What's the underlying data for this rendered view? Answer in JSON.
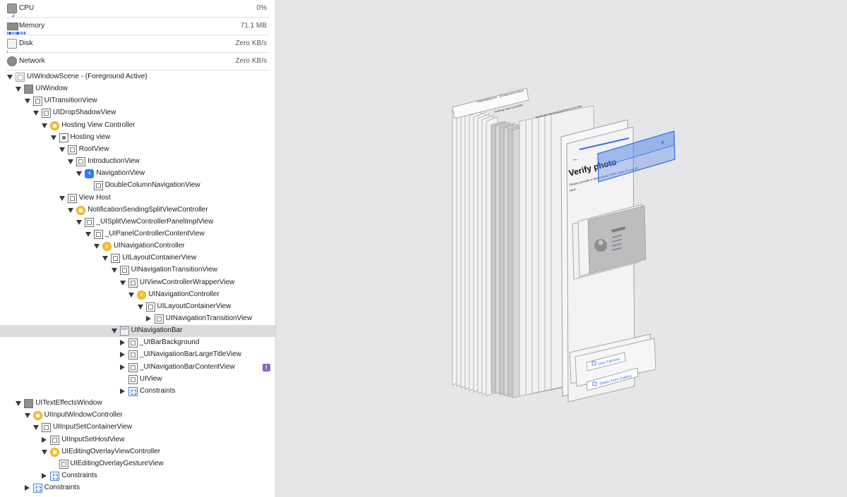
{
  "gauges": [
    {
      "label": "CPU",
      "value": "0%",
      "icon": "cpu-icon"
    },
    {
      "label": "Memory",
      "value": "71.1 MB",
      "icon": "memory-icon"
    },
    {
      "label": "Disk",
      "value": "Zero KB/s",
      "icon": "disk-icon"
    },
    {
      "label": "Network",
      "value": "Zero KB/s",
      "icon": "network-icon"
    }
  ],
  "tree": [
    {
      "label": "UIWindowScene - (Foreground Active)",
      "depth": 0,
      "expand": "open",
      "icon": "scene"
    },
    {
      "label": "UIWindow",
      "depth": 1,
      "expand": "open",
      "icon": "window"
    },
    {
      "label": "UITransitionView",
      "depth": 2,
      "expand": "open",
      "icon": "view"
    },
    {
      "label": "UIDropShadowView",
      "depth": 3,
      "expand": "open",
      "icon": "view"
    },
    {
      "label": "Hosting View Controller",
      "depth": 4,
      "expand": "open",
      "icon": "controller"
    },
    {
      "label": "Hosting view",
      "depth": 5,
      "expand": "open",
      "icon": "hosting"
    },
    {
      "label": "RootView",
      "depth": 6,
      "expand": "open",
      "icon": "view"
    },
    {
      "label": "IntroductionView",
      "depth": 7,
      "expand": "open",
      "icon": "view"
    },
    {
      "label": "NavigationView",
      "depth": 8,
      "expand": "open",
      "icon": "navview"
    },
    {
      "label": "DoubleColumnNavigationView",
      "depth": 9,
      "expand": "none",
      "icon": "view"
    },
    {
      "label": "View Host",
      "depth": 6,
      "expand": "open",
      "icon": "view"
    },
    {
      "label": "NotificationSendingSplitViewController",
      "depth": 7,
      "expand": "open",
      "icon": "controller"
    },
    {
      "label": "_UISplitViewControllerPanelImplView",
      "depth": 8,
      "expand": "open",
      "icon": "view"
    },
    {
      "label": "_UIPanelControllerContentView",
      "depth": 9,
      "expand": "open",
      "icon": "view"
    },
    {
      "label": "UINavigationController",
      "depth": 10,
      "expand": "open",
      "icon": "navctrl"
    },
    {
      "label": "UILayoutContainerView",
      "depth": 11,
      "expand": "open",
      "icon": "view"
    },
    {
      "label": "UINavigationTransitionView",
      "depth": 12,
      "expand": "open",
      "icon": "view"
    },
    {
      "label": "UIViewControllerWrapperView",
      "depth": 13,
      "expand": "open",
      "icon": "view"
    },
    {
      "label": "UINavigationController",
      "depth": 14,
      "expand": "open",
      "icon": "navctrl"
    },
    {
      "label": "UILayoutContainerView",
      "depth": 15,
      "expand": "open",
      "icon": "view"
    },
    {
      "label": "UINavigationTransitionView",
      "depth": 16,
      "expand": "closed",
      "icon": "view"
    },
    {
      "label": "UINavigationBar",
      "depth": 12,
      "expand": "open",
      "icon": "navbar",
      "selected": true
    },
    {
      "label": "_UIBarBackground",
      "depth": 13,
      "expand": "closed",
      "icon": "view"
    },
    {
      "label": "_UINavigationBarLargeTitleView",
      "depth": 13,
      "expand": "closed",
      "icon": "view"
    },
    {
      "label": "_UINavigationBarContentView",
      "depth": 13,
      "expand": "closed",
      "icon": "view",
      "warning": "!"
    },
    {
      "label": "UIView",
      "depth": 13,
      "expand": "none",
      "icon": "view"
    },
    {
      "label": "Constraints",
      "depth": 13,
      "expand": "closed",
      "icon": "constraint"
    },
    {
      "label": "UITextEffectsWindow",
      "depth": 1,
      "expand": "open",
      "icon": "window"
    },
    {
      "label": "UIInputWindowController",
      "depth": 2,
      "expand": "open",
      "icon": "controller"
    },
    {
      "label": "UIInputSetContainerView",
      "depth": 3,
      "expand": "open",
      "icon": "view"
    },
    {
      "label": "UIInputSetHostView",
      "depth": 4,
      "expand": "closed",
      "icon": "view"
    },
    {
      "label": "UIEditingOverlayViewController",
      "depth": 4,
      "expand": "open",
      "icon": "controller"
    },
    {
      "label": "UIEditingOverlayGestureView",
      "depth": 5,
      "expand": "none",
      "icon": "view"
    },
    {
      "label": "Constraints",
      "depth": 4,
      "expand": "closed",
      "icon": "constraint"
    },
    {
      "label": "Constraints",
      "depth": 2,
      "expand": "closed",
      "icon": "constraint"
    }
  ],
  "canvas": {
    "scene_title": "UIWindowScene - (Foreground Active)",
    "hosting_title": "Hosting View Controller",
    "split_title": "NotificationSendingSplitViewController",
    "back_glyph": "←",
    "close_glyph": "x",
    "heading": "Verify photo",
    "subtext_line1": "Please provide a clear photo of the front of your ID",
    "subtext_line2": "card",
    "use_camera": "Use Camera",
    "select_gallery": "Select from Gallery",
    "accent": "#2f6fe8"
  }
}
